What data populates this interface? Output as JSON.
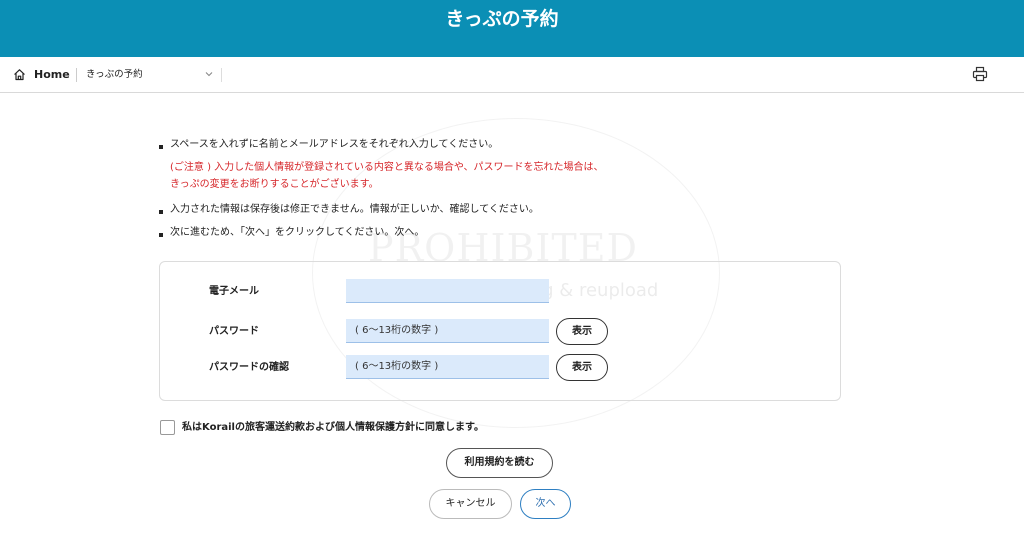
{
  "header": {
    "title": "きっぷの予約"
  },
  "breadcrumb": {
    "home": "Home",
    "current": "きっぷの予約"
  },
  "notes": {
    "line1": "スペースを入れずに名前とメールアドレスをそれぞれ入力してください。",
    "warning1": "(ご注意 ) 入力した個人情報が登録されている内容と異なる場合や、パスワードを忘れた場合は、",
    "warning2": "きっぷの変更をお断りすることがございます。",
    "line2": "入力された情報は保存後は修正できません。情報が正しいか、確認してください。",
    "line3": "次に進むため、「次へ」をクリックしてください。次へ。"
  },
  "watermark": {
    "main": "PROHIBITED",
    "sub": "Repost & AI Training & reupload"
  },
  "form": {
    "email_label": "電子メール",
    "email_value": "",
    "password_label": "パスワード",
    "password_placeholder": "( 6～13桁の数字 )",
    "password_confirm_label": "パスワードの確認",
    "password_confirm_placeholder": "( 6～13桁の数字 )",
    "show_label": "表示"
  },
  "agreement": {
    "label": "私はKorailの旅客運送約款および個人情報保護方針に同意します。",
    "checked": false
  },
  "buttons": {
    "terms": "利用規約を読む",
    "cancel": "キャンセル",
    "next": "次へ"
  },
  "colors": {
    "header_bg": "#0b8fb5",
    "warning": "#d6262a",
    "input_bg": "#dbeafb",
    "next_border": "#2e7fc2"
  }
}
